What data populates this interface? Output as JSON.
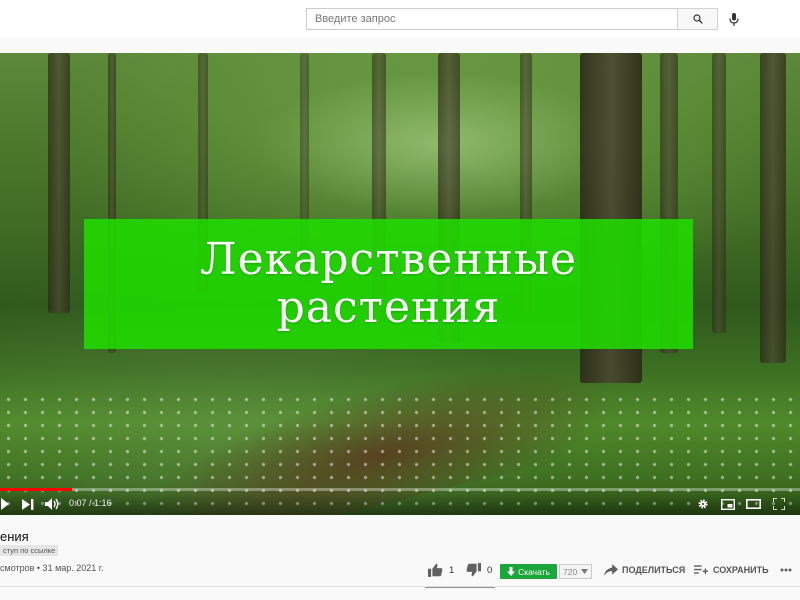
{
  "search": {
    "placeholder": "Введите запрос"
  },
  "video": {
    "overlay_title_line1": "Лекарственные",
    "overlay_title_line2": "растения",
    "time": "0:07 / 1:16",
    "progress_fraction": 0.09
  },
  "info": {
    "title": "ения",
    "access_badge": "ступ по ссылке",
    "meta": "смотров • 31 мар. 2021 г.",
    "likes": "1",
    "dislikes": "0",
    "download_label": "Скачать",
    "quality": "720",
    "share_label": "ПОДЕЛИТЬСЯ",
    "save_label": "СОХРАНИТЬ"
  },
  "colors": {
    "banner": "#20dc00",
    "progress": "#ff0000",
    "download": "#1aa63a"
  },
  "icons": {
    "search": "search-icon",
    "mic": "mic-icon",
    "play": "play-icon",
    "next": "next-icon",
    "volume": "volume-icon",
    "settings": "gear-icon",
    "miniplayer": "miniplayer-icon",
    "theater": "theater-icon",
    "fullscreen": "fullscreen-icon",
    "like": "thumb-up-icon",
    "dislike": "thumb-down-icon",
    "download": "download-arrow-icon",
    "share": "share-arrow-icon",
    "save": "playlist-add-icon",
    "more": "more-dots-icon"
  }
}
